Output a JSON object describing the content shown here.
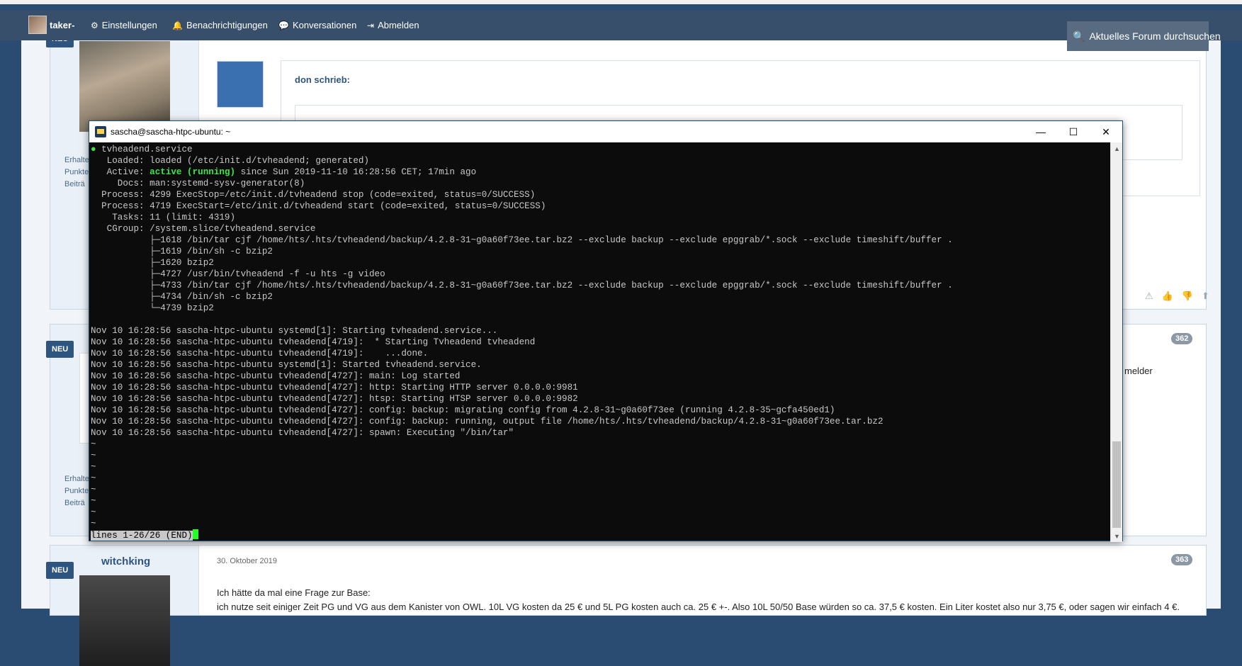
{
  "nav": {
    "username": "taker-",
    "settings": "Einstellungen",
    "notifications": "Benachrichtigungen",
    "conversations": "Konversationen",
    "logout": "Abmelden",
    "search_placeholder": "Aktuelles Forum durchsuchen"
  },
  "posts": {
    "badge_new": "NEU",
    "post1": {
      "quote_header": "don schrieb:"
    },
    "post2": {
      "number": "362",
      "text_fragment": "melder"
    },
    "post3": {
      "username": "witchking",
      "date": "30. Oktober 2019",
      "number": "363",
      "line1": "Ich hätte da mal eine Frage zur Base:",
      "line2": "ich nutze seit einiger Zeit PG und VG aus dem Kanister von OWL. 10L VG kosten da 25 € und 5L PG kosten auch ca. 25 € +-. Also 10L 50/50 Base würden so ca. 37,5 € kosten. Ein Liter kostet also nur 3,75 €, oder sagen wir einfach 4 €."
    },
    "stats": {
      "received": "Erhalte",
      "points": "Punkte",
      "posts": "Beiträ"
    }
  },
  "terminal": {
    "title": "sascha@sascha-htpc-ubuntu: ~",
    "lines": [
      {
        "pre": "",
        "bullet": "●",
        "text": " tvheadend.service"
      },
      {
        "pre": "",
        "text": "   Loaded: loaded (/etc/init.d/tvheadend; generated)"
      },
      {
        "pre": "   Active: ",
        "green": "active (running)",
        "text": " since Sun 2019-11-10 16:28:56 CET; 17min ago"
      },
      {
        "pre": "",
        "text": "     Docs: man:systemd-sysv-generator(8)"
      },
      {
        "pre": "",
        "text": "  Process: 4299 ExecStop=/etc/init.d/tvheadend stop (code=exited, status=0/SUCCESS)"
      },
      {
        "pre": "",
        "text": "  Process: 4719 ExecStart=/etc/init.d/tvheadend start (code=exited, status=0/SUCCESS)"
      },
      {
        "pre": "",
        "text": "    Tasks: 11 (limit: 4319)"
      },
      {
        "pre": "",
        "text": "   CGroup: /system.slice/tvheadend.service"
      },
      {
        "pre": "",
        "text": "           ├─1618 /bin/tar cjf /home/hts/.hts/tvheadend/backup/4.2.8-31~g0a60f73ee.tar.bz2 --exclude backup --exclude epggrab/*.sock --exclude timeshift/buffer ."
      },
      {
        "pre": "",
        "text": "           ├─1619 /bin/sh -c bzip2"
      },
      {
        "pre": "",
        "text": "           ├─1620 bzip2"
      },
      {
        "pre": "",
        "text": "           ├─4727 /usr/bin/tvheadend -f -u hts -g video"
      },
      {
        "pre": "",
        "text": "           ├─4733 /bin/tar cjf /home/hts/.hts/tvheadend/backup/4.2.8-31~g0a60f73ee.tar.bz2 --exclude backup --exclude epggrab/*.sock --exclude timeshift/buffer ."
      },
      {
        "pre": "",
        "text": "           ├─4734 /bin/sh -c bzip2"
      },
      {
        "pre": "",
        "text": "           └─4739 bzip2"
      },
      {
        "pre": "",
        "text": ""
      },
      {
        "pre": "",
        "text": "Nov 10 16:28:56 sascha-htpc-ubuntu systemd[1]: Starting tvheadend.service..."
      },
      {
        "pre": "",
        "text": "Nov 10 16:28:56 sascha-htpc-ubuntu tvheadend[4719]:  * Starting Tvheadend tvheadend"
      },
      {
        "pre": "",
        "text": "Nov 10 16:28:56 sascha-htpc-ubuntu tvheadend[4719]:    ...done."
      },
      {
        "pre": "",
        "text": "Nov 10 16:28:56 sascha-htpc-ubuntu systemd[1]: Started tvheadend.service."
      },
      {
        "pre": "",
        "text": "Nov 10 16:28:56 sascha-htpc-ubuntu tvheadend[4727]: main: Log started"
      },
      {
        "pre": "",
        "text": "Nov 10 16:28:56 sascha-htpc-ubuntu tvheadend[4727]: http: Starting HTTP server 0.0.0.0:9981"
      },
      {
        "pre": "",
        "text": "Nov 10 16:28:56 sascha-htpc-ubuntu tvheadend[4727]: htsp: Starting HTSP server 0.0.0.0:9982"
      },
      {
        "pre": "",
        "text": "Nov 10 16:28:56 sascha-htpc-ubuntu tvheadend[4727]: config: backup: migrating config from 4.2.8-31~g0a60f73ee (running 4.2.8-35~gcfa450ed1)"
      },
      {
        "pre": "",
        "text": "Nov 10 16:28:56 sascha-htpc-ubuntu tvheadend[4727]: config: backup: running, output file /home/hts/.hts/tvheadend/backup/4.2.8-31~g0a60f73ee.tar.bz2"
      },
      {
        "pre": "",
        "text": "Nov 10 16:28:56 sascha-htpc-ubuntu tvheadend[4727]: spawn: Executing \"/bin/tar\""
      },
      {
        "pre": "",
        "text": "~"
      },
      {
        "pre": "",
        "text": "~"
      },
      {
        "pre": "",
        "text": "~"
      },
      {
        "pre": "",
        "text": "~"
      },
      {
        "pre": "",
        "text": "~"
      },
      {
        "pre": "",
        "text": "~"
      },
      {
        "pre": "",
        "text": "~"
      },
      {
        "pre": "",
        "text": "~"
      }
    ],
    "status": "lines 1-26/26 (END)",
    "colors": {
      "active": "#3ee648",
      "cursor": "#22ff22"
    }
  }
}
